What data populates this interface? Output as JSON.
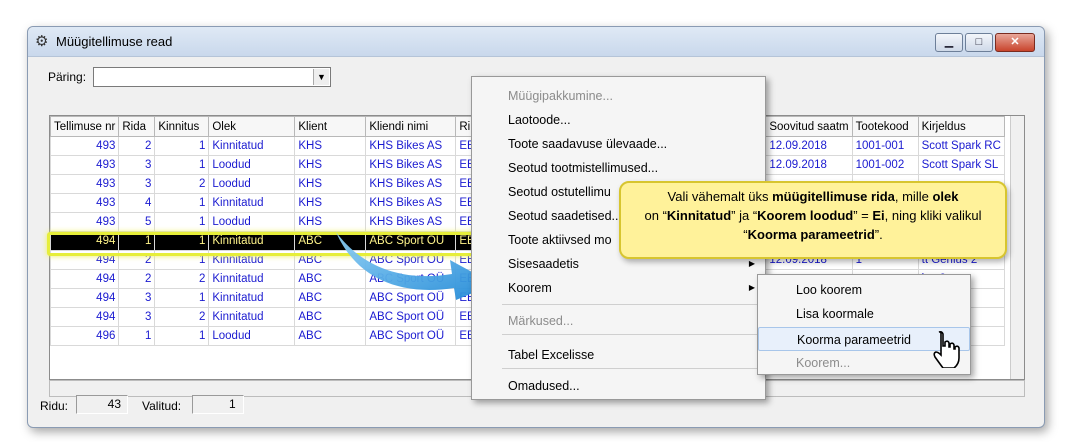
{
  "window": {
    "title": "Müügitellimuse read",
    "minimize": "▁",
    "maximize": "□",
    "close": "✕"
  },
  "query": {
    "label": "Päring:",
    "value": ""
  },
  "columns": [
    "Tellimuse nr",
    "Rida",
    "Kinnitus",
    "Olek",
    "Klient",
    "Kliendi nimi",
    "Rii",
    "Soovitud saatm",
    "Tootekood",
    "Kirjeldus"
  ],
  "rows": [
    {
      "order": "493",
      "row": "2",
      "conf": "1",
      "state": "Kinnitatud",
      "client": "KHS",
      "name": "KHS Bikes AS",
      "c": "EE",
      "date": "12.09.2018",
      "code": "1001-001",
      "desc": "Scott Spark RC"
    },
    {
      "order": "493",
      "row": "3",
      "conf": "1",
      "state": "Loodud",
      "client": "KHS",
      "name": "KHS Bikes AS",
      "c": "EE",
      "date": "12.09.2018",
      "code": "1001-002",
      "desc": "Scott Spark SL"
    },
    {
      "order": "493",
      "row": "3",
      "conf": "2",
      "state": "Loodud",
      "client": "KHS",
      "name": "KHS Bikes AS",
      "c": "EE",
      "date": "",
      "code": "",
      "desc": ""
    },
    {
      "order": "493",
      "row": "4",
      "conf": "1",
      "state": "Kinnitatud",
      "client": "KHS",
      "name": "KHS Bikes AS",
      "c": "EE",
      "date": "",
      "code": "",
      "desc": ""
    },
    {
      "order": "493",
      "row": "5",
      "conf": "1",
      "state": "Loodud",
      "client": "KHS",
      "name": "KHS Bikes AS",
      "c": "EE",
      "date": "",
      "code": "",
      "desc": ""
    },
    {
      "order": "494",
      "row": "1",
      "conf": "1",
      "state": "Kinnitatud",
      "client": "ABC",
      "name": "ABC Sport OÜ",
      "c": "EE",
      "date": "",
      "code": "",
      "desc": ""
    },
    {
      "order": "494",
      "row": "2",
      "conf": "1",
      "state": "Kinnitatud",
      "client": "ABC",
      "name": "ABC Sport OÜ",
      "c": "EE",
      "date": "12.09.2018",
      "code": "1",
      "desc": "tt Genius 2"
    },
    {
      "order": "494",
      "row": "2",
      "conf": "2",
      "state": "Kinnitatud",
      "client": "ABC",
      "name": "ABC Sport OÜ",
      "c": "EE",
      "date": "",
      "code": "",
      "desc": "ius 2"
    },
    {
      "order": "494",
      "row": "3",
      "conf": "1",
      "state": "Kinnitatud",
      "client": "ABC",
      "name": "ABC Sport OÜ",
      "c": "EE",
      "date": "",
      "code": "",
      "desc": "ect 2"
    },
    {
      "order": "494",
      "row": "3",
      "conf": "2",
      "state": "Kinnitatud",
      "client": "ABC",
      "name": "ABC Sport OÜ",
      "c": "EE",
      "date": "",
      "code": "",
      "desc": "ect 2"
    },
    {
      "order": "496",
      "row": "1",
      "conf": "1",
      "state": "Loodud",
      "client": "ABC",
      "name": "ABC Sport OÜ",
      "c": "EE",
      "date": "",
      "code": "",
      "desc": "el 29"
    }
  ],
  "status": {
    "rows_label": "Ridu:",
    "rows_value": "43",
    "selected_label": "Valitud:",
    "selected_value": "1"
  },
  "menu": {
    "items": [
      "Müügipakkumine...",
      "Laotoode...",
      "Toote saadavuse ülevaade...",
      "Seotud tootmistellimused...",
      "Seotud ostutellimu",
      "Seotud saadetised...",
      "Toote aktiivsed mo",
      "Sisesaadetis",
      "Koorem",
      "Märkused...",
      "Tabel Excelisse",
      "Omadused..."
    ]
  },
  "submenu": {
    "items": [
      "Loo koorem",
      "Lisa koormale",
      "Koorma parameetrid",
      "Koorem..."
    ]
  },
  "callout": {
    "p1": "Vali vähemalt üks ",
    "b1": "müügitellimuse rida",
    "p2": ", mille ",
    "b2": "olek",
    "p3": " on  “",
    "b3": "Kinnitatud",
    "p4": "” ja “",
    "b4": "Koorem loodud",
    "p5": "”  = ",
    "b5": "Ei",
    "p6": ", ning kliki valikul “",
    "b6": "Koorma parameetrid",
    "p7": "”."
  },
  "colors": {
    "accent": "#1a1ad0",
    "highlight": "#e6ee3a",
    "callout": "#fff29a"
  }
}
